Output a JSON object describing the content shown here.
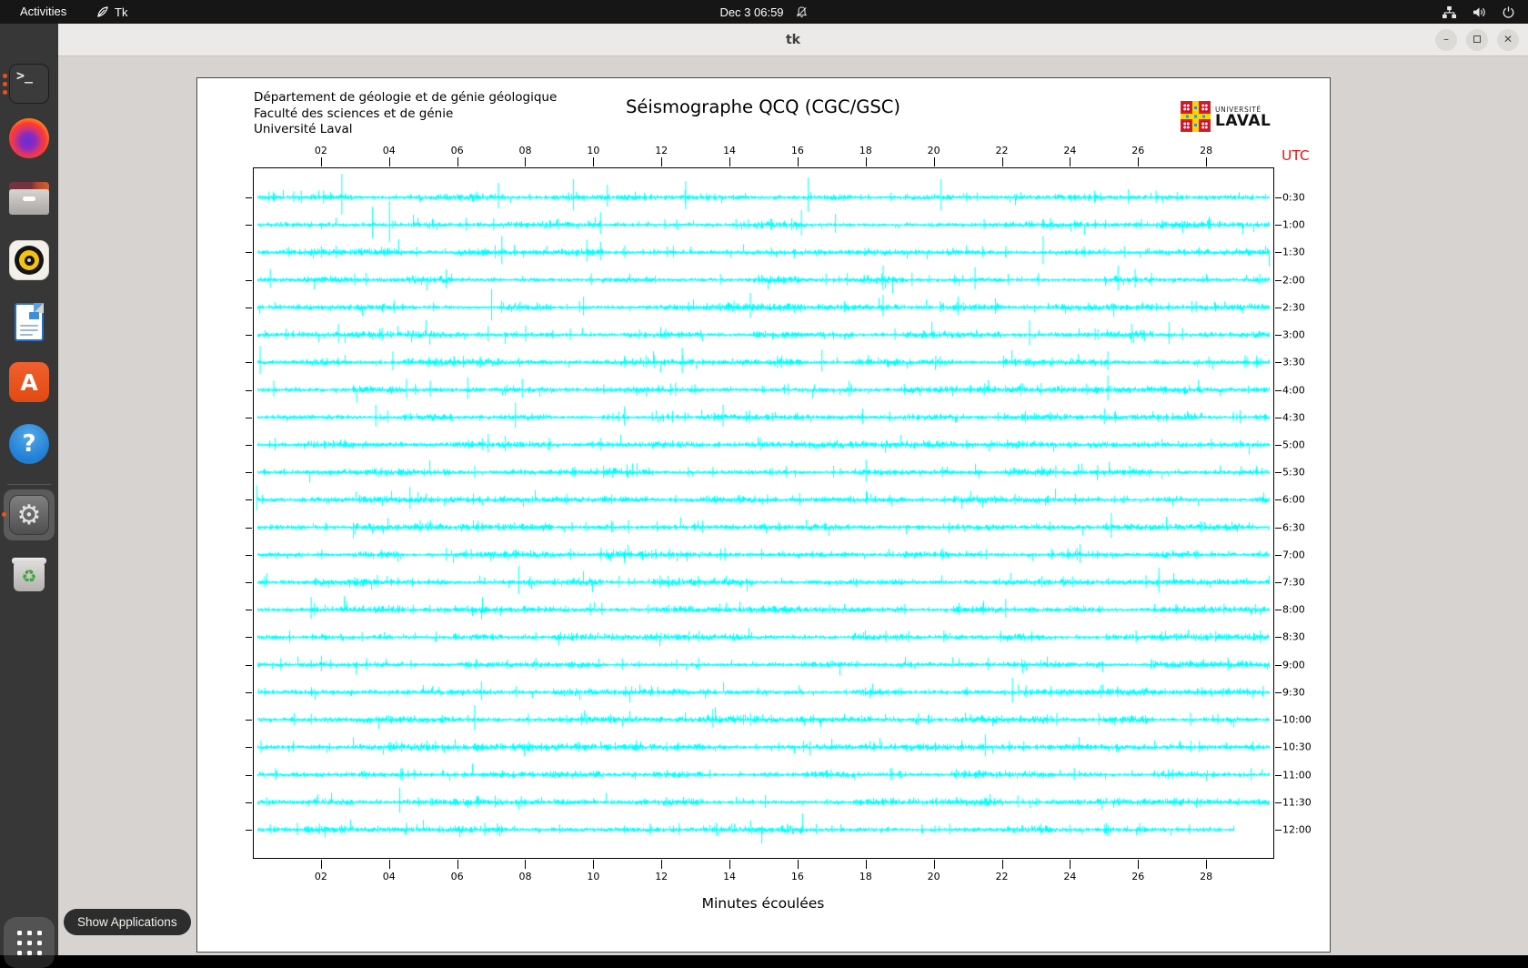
{
  "topbar": {
    "activities": "Activities",
    "app_name": "Tk",
    "clock": "Dec 3  06:59"
  },
  "window": {
    "title": "tk"
  },
  "dock": {
    "tooltip": "Show Applications"
  },
  "plot_header": {
    "line1": "Département de géologie et de génie géologique",
    "line2": "Faculté des sciences et de génie",
    "line3": "Université Laval"
  },
  "logo": {
    "line1": "UNIVERSITÉ",
    "line2": "LAVAL"
  },
  "colors": {
    "trace": "#00ffff",
    "utc_red": "#f01010",
    "ubuntu_orange": "#e95420"
  },
  "chart_data": {
    "type": "seismograph",
    "title": "Séismographe QCQ (CGC/GSC)",
    "xlabel": "Minutes écoulées",
    "right_axis_title": "UTC",
    "x_range_minutes": [
      0,
      30
    ],
    "x_ticks": [
      "02",
      "04",
      "06",
      "08",
      "10",
      "12",
      "14",
      "16",
      "18",
      "20",
      "22",
      "24",
      "26",
      "28"
    ],
    "trace_color": "#00ffff",
    "seed": 12,
    "rows": [
      {
        "utc": "0:30",
        "spikes": [
          [
            2.6,
            26
          ],
          [
            7.2,
            16
          ],
          [
            9.4,
            20
          ],
          [
            10.4,
            14
          ],
          [
            12.7,
            18
          ],
          [
            16.3,
            22
          ],
          [
            20.2,
            20
          ],
          [
            25.7,
            9
          ]
        ]
      },
      {
        "utc": "1:00",
        "spikes": [
          [
            3.5,
            20
          ],
          [
            4.0,
            26
          ],
          [
            10.2,
            14
          ],
          [
            16.1,
            16
          ],
          [
            17.1,
            12
          ]
        ]
      },
      {
        "utc": "1:30",
        "spikes": [
          [
            7.3,
            18
          ],
          [
            9.8,
            14
          ],
          [
            10.2,
            12
          ],
          [
            23.2,
            18
          ]
        ]
      },
      {
        "utc": "2:00",
        "spikes": [
          [
            0.5,
            12
          ],
          [
            18.5,
            16
          ],
          [
            21.2,
            14
          ],
          [
            25.4,
            16
          ],
          [
            25.9,
            12
          ]
        ]
      },
      {
        "utc": "2:30",
        "spikes": [
          [
            7.0,
            20
          ],
          [
            9.7,
            12
          ],
          [
            14.6,
            16
          ],
          [
            18.5,
            14
          ],
          [
            20.7,
            12
          ],
          [
            21.8,
            10
          ]
        ]
      },
      {
        "utc": "3:00",
        "spikes": [
          [
            2.5,
            12
          ],
          [
            6.9,
            10
          ],
          [
            8.0,
            10
          ],
          [
            22.8,
            16
          ],
          [
            25.8,
            12
          ],
          [
            26.9,
            14
          ]
        ]
      },
      {
        "utc": "3:30",
        "spikes": [
          [
            0.2,
            18
          ],
          [
            4.1,
            12
          ],
          [
            12.6,
            16
          ],
          [
            16.7,
            14
          ],
          [
            25.1,
            12
          ]
        ]
      },
      {
        "utc": "4:00",
        "spikes": [
          [
            0.6,
            10
          ],
          [
            4.5,
            12
          ],
          [
            5.2,
            10
          ],
          [
            6.3,
            14
          ],
          [
            7.9,
            12
          ],
          [
            17.5,
            10
          ],
          [
            25.1,
            16
          ]
        ]
      },
      {
        "utc": "4:30",
        "spikes": [
          [
            3.6,
            14
          ],
          [
            7.7,
            16
          ],
          [
            10.9,
            12
          ],
          [
            13.8,
            14
          ],
          [
            17.9,
            10
          ],
          [
            25.0,
            10
          ]
        ]
      },
      {
        "utc": "5:00",
        "spikes": [
          [
            6.9,
            12
          ],
          [
            7.4,
            10
          ]
        ]
      },
      {
        "utc": "5:30",
        "spikes": [
          [
            18.0,
            14
          ],
          [
            24.8,
            8
          ]
        ]
      },
      {
        "utc": "6:00",
        "spikes": [
          [
            0.1,
            16
          ],
          [
            4.6,
            14
          ]
        ]
      },
      {
        "utc": "6:30",
        "spikes": [
          [
            4.9,
            8
          ],
          [
            25.2,
            16
          ]
        ]
      },
      {
        "utc": "7:00",
        "spikes": []
      },
      {
        "utc": "7:30",
        "spikes": [
          [
            7.8,
            18
          ],
          [
            26.6,
            16
          ]
        ]
      },
      {
        "utc": "8:00",
        "spikes": [
          [
            1.7,
            14
          ],
          [
            22.1,
            12
          ]
        ]
      },
      {
        "utc": "8:30",
        "spikes": []
      },
      {
        "utc": "9:00",
        "spikes": [
          [
            2.0,
            10
          ]
        ]
      },
      {
        "utc": "9:30",
        "spikes": [
          [
            6.7,
            12
          ],
          [
            22.3,
            16
          ]
        ]
      },
      {
        "utc": "10:00",
        "spikes": [
          [
            6.5,
            16
          ],
          [
            13.5,
            12
          ]
        ]
      },
      {
        "utc": "10:30",
        "spikes": [
          [
            21.5,
            14
          ]
        ]
      },
      {
        "utc": "11:00",
        "spikes": []
      },
      {
        "utc": "11:30",
        "spikes": [
          [
            4.3,
            16
          ]
        ]
      },
      {
        "utc": "12:00",
        "spikes": [
          [
            0.5,
            6
          ],
          [
            4.5,
            8
          ],
          [
            9.0,
            6
          ],
          [
            17.0,
            5
          ],
          [
            25.0,
            6
          ]
        ],
        "end": 28.8
      }
    ]
  }
}
